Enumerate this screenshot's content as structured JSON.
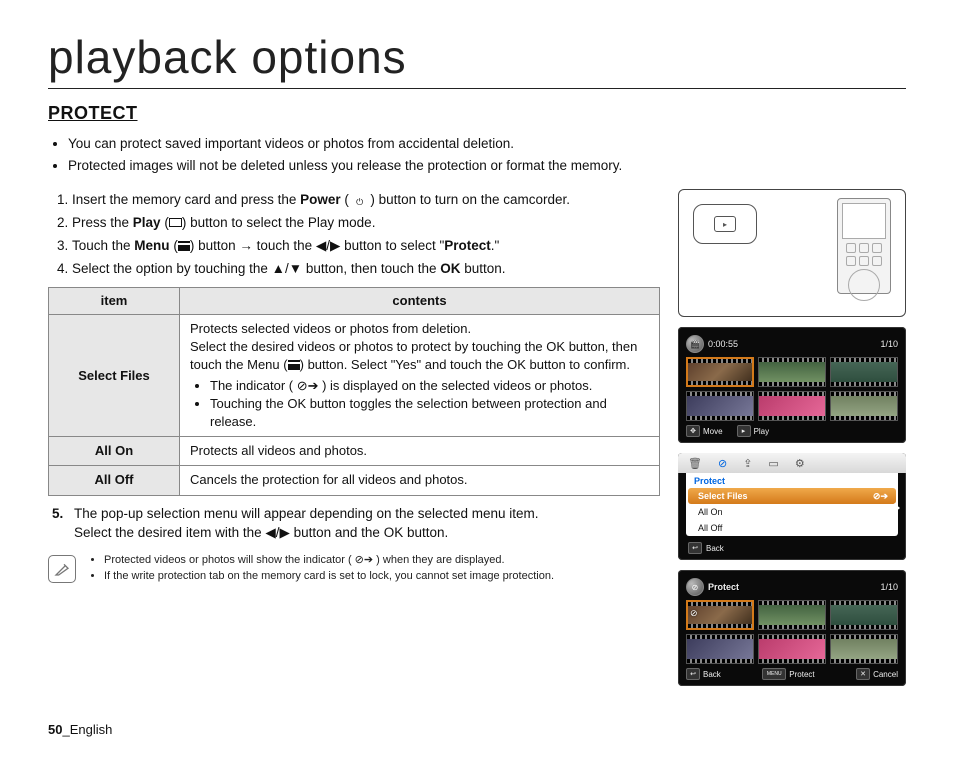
{
  "page": {
    "title": "playback options",
    "section": "PROTECT",
    "page_number": "50",
    "page_lang": "_English"
  },
  "intro": {
    "b1": "You can protect saved important videos or photos from accidental deletion.",
    "b2": "Protected images will not be deleted unless you release the protection or format the memory."
  },
  "steps": {
    "s1a": "Insert the memory card and press the ",
    "s1b": "Power",
    "s1c": " button to turn on the camcorder.",
    "s2a": "Press the ",
    "s2b": "Play",
    "s2c": " button to select the Play mode.",
    "s3a": "Touch the ",
    "s3b": "Menu",
    "s3c": " button → touch the ◀/▶ button to select \"",
    "s3d": "Protect",
    "s3e": ".\"",
    "s4a": "Select the option by touching the ▲/▼ button, then touch the ",
    "s4b": "OK",
    "s4c": " button.",
    "s5a": "The pop-up selection menu will appear depending on the selected menu item.",
    "s5b_a": "Select the desired item with the ◀/▶ button and the ",
    "s5b_b": "OK",
    "s5b_c": " button."
  },
  "table": {
    "h_item": "item",
    "h_contents": "contents",
    "row1_head": "Select Files",
    "row1_p1": "Protects selected videos or photos from deletion.",
    "row1_p2a": "Select the desired videos or photos to protect by touching the ",
    "row1_p2b": "OK",
    "row1_p2c": " button, then touch the ",
    "row1_p2d": "Menu",
    "row1_p2e": " button. Select ",
    "row1_p2f": "\"Yes\"",
    "row1_p2g": " and touch the ",
    "row1_p2h": "OK",
    "row1_p2i": " button to confirm.",
    "row1_li1": "The indicator ( ⊘➔ ) is displayed on the selected videos or photos.",
    "row1_li2a": "Touching the ",
    "row1_li2b": "OK",
    "row1_li2c": " button toggles the selection between protection and release.",
    "row2_head": "All On",
    "row2_text": "Protects all videos and photos.",
    "row3_head": "All Off",
    "row3_text": "Cancels the protection for all videos and photos."
  },
  "notes": {
    "n1": "Protected videos or photos will show the indicator ( ⊘➔ ) when they are displayed.",
    "n2": "If the write protection tab on the memory card is set to lock, you cannot set image protection."
  },
  "screen1": {
    "time": "0:00:55",
    "count": "1/10",
    "move": "Move",
    "play": "Play"
  },
  "screen2": {
    "title": "Protect",
    "opt1": "Select Files",
    "opt2": "All On",
    "opt3": "All Off",
    "back": "Back"
  },
  "screen3": {
    "title": "Protect",
    "count": "1/10",
    "back": "Back",
    "protect": "Protect",
    "cancel": "Cancel",
    "menu_label": "MENU"
  }
}
